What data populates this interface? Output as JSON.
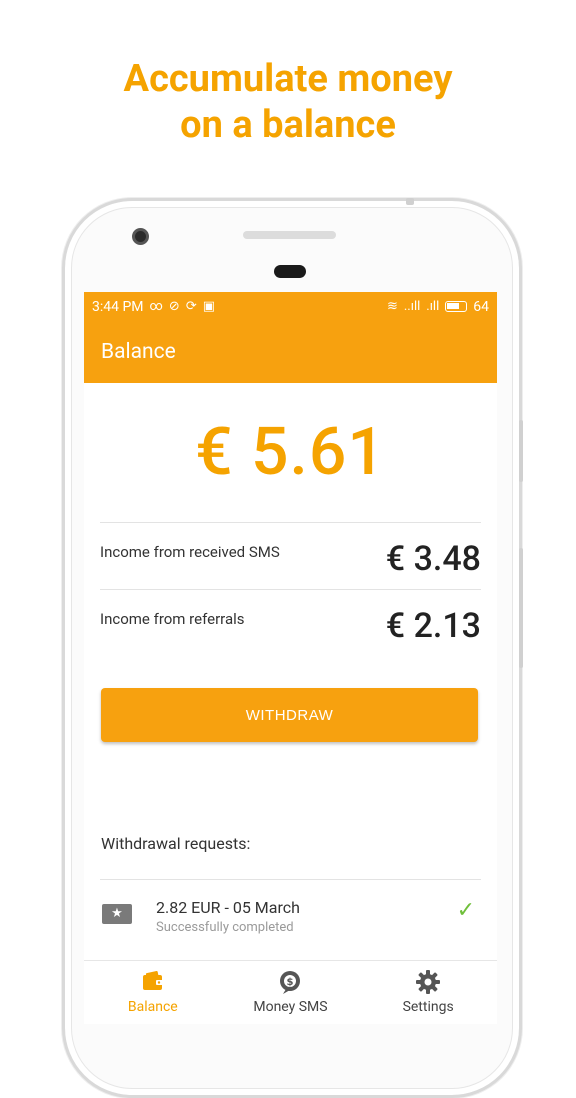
{
  "promo": {
    "line1": "Accumulate money",
    "line2": "on a balance"
  },
  "statusbar": {
    "time": "3:44 PM",
    "left_icons": [
      "infinity-icon",
      "check-circle-icon",
      "sync-icon",
      "bag-icon"
    ],
    "signal1": "..ıll",
    "signal2": ".ıll",
    "battery": "64"
  },
  "appbar": {
    "title": "Balance"
  },
  "balance": {
    "total": "€ 5.61",
    "income": [
      {
        "label": "Income from received SMS",
        "value": "€ 3.48"
      },
      {
        "label": "Income from referrals",
        "value": "€ 2.13"
      }
    ],
    "withdraw_label": "WITHDRAW"
  },
  "withdrawals": {
    "title": "Withdrawal requests:",
    "items": [
      {
        "title": "2.82 EUR - 05 March",
        "status": "Successfully completed",
        "icon": "star-card-icon",
        "status_icon": "check-icon"
      }
    ]
  },
  "nav": {
    "items": [
      {
        "label": "Balance",
        "icon": "wallet-icon",
        "active": true
      },
      {
        "label": "Money SMS",
        "icon": "money-chat-icon",
        "active": false
      },
      {
        "label": "Settings",
        "icon": "gear-icon",
        "active": false
      }
    ]
  },
  "colors": {
    "accent": "#F7A10F",
    "success": "#6fbf3a"
  }
}
